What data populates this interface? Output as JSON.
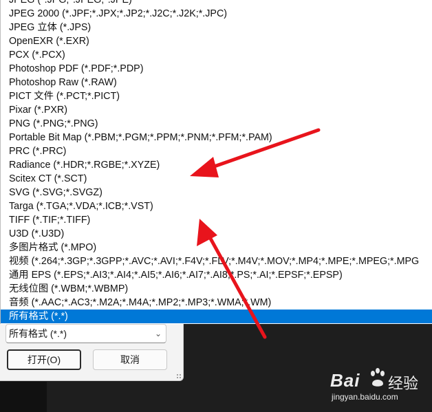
{
  "dropdown": {
    "items": [
      "JPEG (*.JPG;*.JPEG;*.JPE)",
      "JPEG 2000 (*.JPF;*.JPX;*.JP2;*.J2C;*.J2K;*.JPC)",
      "JPEG 立体 (*.JPS)",
      "OpenEXR (*.EXR)",
      "PCX (*.PCX)",
      "Photoshop PDF (*.PDF;*.PDP)",
      "Photoshop Raw (*.RAW)",
      "PICT 文件 (*.PCT;*.PICT)",
      "Pixar (*.PXR)",
      "PNG (*.PNG;*.PNG)",
      "Portable Bit Map (*.PBM;*.PGM;*.PPM;*.PNM;*.PFM;*.PAM)",
      "PRC (*.PRC)",
      "Radiance (*.HDR;*.RGBE;*.XYZE)",
      "Scitex CT (*.SCT)",
      "SVG (*.SVG;*.SVGZ)",
      "Targa (*.TGA;*.VDA;*.ICB;*.VST)",
      "TIFF (*.TIF;*.TIFF)",
      "U3D (*.U3D)",
      "多图片格式 (*.MPO)",
      "视频 (*.264;*.3GP;*.3GPP;*.AVC;*.AVI;*.F4V;*.FLV;*.M4V;*.MOV;*.MP4;*.MPE;*.MPEG;*.MPG",
      "通用 EPS (*.EPS;*.AI3;*.AI4;*.AI5;*.AI6;*.AI7;*.AI8;*.PS;*.AI;*.EPSF;*.EPSP)",
      "无线位图 (*.WBM;*.WBMP)",
      "音频 (*.AAC;*.AC3;*.M2A;*.M4A;*.MP2;*.MP3;*.WMA;*.WM)",
      "所有格式 (*.*)"
    ],
    "selected_index": 23
  },
  "filter": {
    "value": "所有格式 (*.*)"
  },
  "buttons": {
    "open_label": "打开(O)",
    "cancel_label": "取消"
  },
  "watermark": {
    "logo_text": "Bai",
    "brand_text": "经验",
    "url_text": "jingyan.baidu.com"
  },
  "colors": {
    "selection": "#0078d7",
    "annotation_arrow": "#e8141c"
  }
}
